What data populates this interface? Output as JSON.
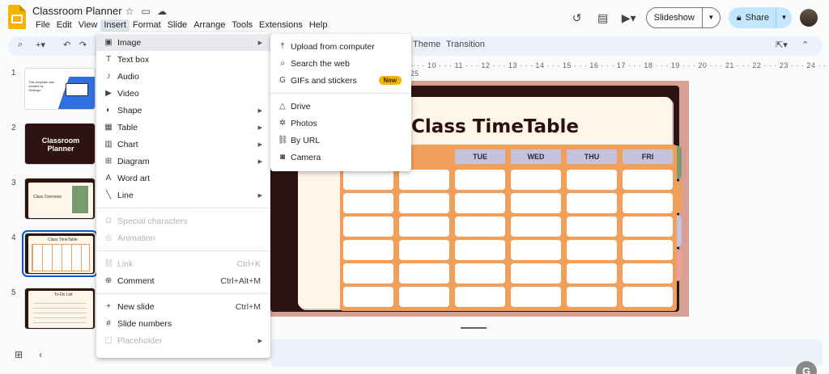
{
  "app": {
    "title": "Classroom Planner",
    "menus": [
      "File",
      "Edit",
      "View",
      "Insert",
      "Format",
      "Slide",
      "Arrange",
      "Tools",
      "Extensions",
      "Help"
    ]
  },
  "header": {
    "slideshow_label": "Slideshow",
    "share_label": "Share"
  },
  "toolbar": {
    "theme_label": "Theme",
    "transition_label": "Transition"
  },
  "ruler": "8 · · · 10 · · · 11 · · · 12 · · · 13 · · · 14 · · · 15 · · · 16 · · · 17 · · · 18 · · · 19 · · · 20 · · · 21 · · · 22 · · · 23 · · · 24 · · · 25",
  "filmstrip": [
    {
      "num": "1",
      "text": "This template was created by Slidesgo"
    },
    {
      "num": "2",
      "text": "Classroom Planner"
    },
    {
      "num": "3",
      "text": "Class Overview"
    },
    {
      "num": "4",
      "text": "Class TimeTable"
    },
    {
      "num": "5",
      "text": "To-Do List"
    }
  ],
  "slide": {
    "title": "Class TimeTable",
    "days": [
      "TUE",
      "WED",
      "THU",
      "FRI"
    ]
  },
  "insert_menu": {
    "items": [
      {
        "label": "Image",
        "icon": "image-icon",
        "glyph": "▣",
        "arrow": true,
        "highlight": true
      },
      {
        "label": "Text box",
        "icon": "textbox-icon",
        "glyph": "T"
      },
      {
        "label": "Audio",
        "icon": "audio-icon",
        "glyph": "♪"
      },
      {
        "label": "Video",
        "icon": "video-icon",
        "glyph": "▶"
      },
      {
        "label": "Shape",
        "icon": "shape-icon",
        "glyph": "◐",
        "arrow": true
      },
      {
        "label": "Table",
        "icon": "table-icon",
        "glyph": "▦",
        "arrow": true
      },
      {
        "label": "Chart",
        "icon": "chart-icon",
        "glyph": "▥",
        "arrow": true
      },
      {
        "label": "Diagram",
        "icon": "diagram-icon",
        "glyph": "⊞",
        "arrow": true
      },
      {
        "label": "Word art",
        "icon": "wordart-icon",
        "glyph": "A"
      },
      {
        "label": "Line",
        "icon": "line-icon",
        "glyph": "╲",
        "arrow": true
      }
    ],
    "group2": [
      {
        "label": "Special characters",
        "icon": "omega-icon",
        "glyph": "Ω",
        "disabled": true
      },
      {
        "label": "Animation",
        "icon": "animation-icon",
        "glyph": "◎",
        "disabled": true
      }
    ],
    "group3": [
      {
        "label": "Link",
        "icon": "link-icon",
        "glyph": "⛓",
        "shortcut": "Ctrl+K",
        "disabled": true
      },
      {
        "label": "Comment",
        "icon": "comment-icon",
        "glyph": "⊕",
        "shortcut": "Ctrl+Alt+M"
      }
    ],
    "group4": [
      {
        "label": "New slide",
        "icon": "plus-icon",
        "glyph": "+",
        "shortcut": "Ctrl+M"
      },
      {
        "label": "Slide numbers",
        "icon": "hash-icon",
        "glyph": "#"
      },
      {
        "label": "Placeholder",
        "icon": "placeholder-icon",
        "glyph": "▢",
        "arrow": true,
        "disabled": true
      }
    ]
  },
  "image_submenu": {
    "items": [
      {
        "label": "Upload from computer",
        "icon": "upload-icon",
        "glyph": "⤒"
      },
      {
        "label": "Search the web",
        "icon": "search-icon",
        "glyph": "⌕"
      },
      {
        "label": "GIFs and stickers",
        "icon": "gif-icon",
        "glyph": "G",
        "badge": "New"
      }
    ],
    "items2": [
      {
        "label": "Drive",
        "icon": "drive-icon",
        "glyph": "△"
      },
      {
        "label": "Photos",
        "icon": "photos-icon",
        "glyph": "✲"
      },
      {
        "label": "By URL",
        "icon": "link-icon",
        "glyph": "⛓"
      },
      {
        "label": "Camera",
        "icon": "camera-icon",
        "glyph": "◙"
      }
    ]
  },
  "colors": {
    "accent": "#0b57d0",
    "share_bg": "#c2e7ff",
    "grid_orange": "#f0a05a",
    "day_header": "#c6c2dc",
    "tab_colors": [
      "#7a9b70",
      "#f0a05a",
      "#c6c2dc",
      "#e8a0a0"
    ]
  }
}
